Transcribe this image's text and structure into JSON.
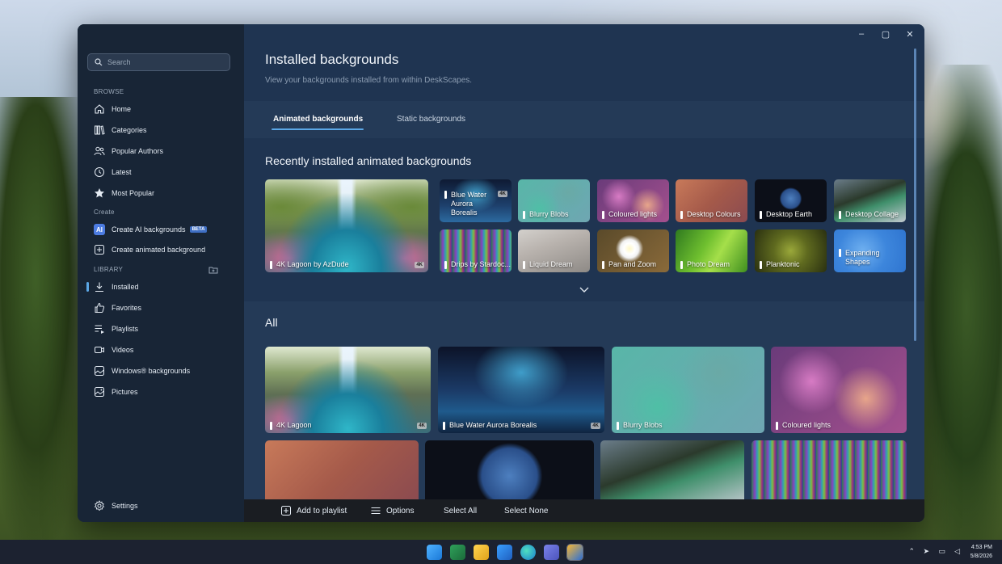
{
  "sidebar": {
    "search_placeholder": "Search",
    "browse_label": "BROWSE",
    "browse_items": [
      "Home",
      "Categories",
      "Popular Authors",
      "Latest",
      "Most Popular"
    ],
    "create_label": "Create",
    "create_items": [
      "Create AI backgrounds",
      "Create animated background"
    ],
    "beta_badge": "BETA",
    "ai_badge": "AI",
    "library_label": "LIBRARY",
    "library_items": [
      "Installed",
      "Favorites",
      "Playlists",
      "Videos",
      "Windows® backgrounds",
      "Pictures"
    ],
    "settings_label": "Settings"
  },
  "window_controls": {
    "minimize": "–",
    "maximize": "▢",
    "close": "✕"
  },
  "header": {
    "title": "Installed backgrounds",
    "subtitle": "View your backgrounds installed from within DeskScapes."
  },
  "tabs": [
    "Animated backgrounds",
    "Static backgrounds"
  ],
  "recent": {
    "title": "Recently installed animated backgrounds",
    "items": [
      {
        "label": "4K Lagoon by AzDude",
        "badge": "4K"
      },
      {
        "label": "Blue Water Aurora Borealis",
        "badge": "4K"
      },
      {
        "label": "Blurry Blobs"
      },
      {
        "label": "Coloured lights"
      },
      {
        "label": "Desktop Colours"
      },
      {
        "label": "Desktop Earth"
      },
      {
        "label": "Desktop Collage"
      },
      {
        "label": "Drips by Stardoc..."
      },
      {
        "label": "Liquid Dream"
      },
      {
        "label": "Pan and Zoom"
      },
      {
        "label": "Photo Dream"
      },
      {
        "label": "Planktonic"
      },
      {
        "label": "Expanding Shapes"
      }
    ]
  },
  "all": {
    "title": "All",
    "items": [
      {
        "label": "4K Lagoon",
        "badge": "4K"
      },
      {
        "label": "Blue Water Aurora Borealis",
        "badge": "4K"
      },
      {
        "label": "Blurry Blobs"
      },
      {
        "label": "Coloured lights"
      }
    ]
  },
  "bottom_bar": {
    "add_to_playlist": "Add to playlist",
    "options": "Options",
    "select_all": "Select All",
    "select_none": "Select None"
  },
  "taskbar": {
    "time": "4:53 PM",
    "date": "5/8/2026",
    "icons": [
      "start-icon",
      "app-icon",
      "file-explorer-icon",
      "mail-icon",
      "edge-icon",
      "teams-icon",
      "deskscapes-icon"
    ]
  },
  "accent_color": "#5ba7e6"
}
